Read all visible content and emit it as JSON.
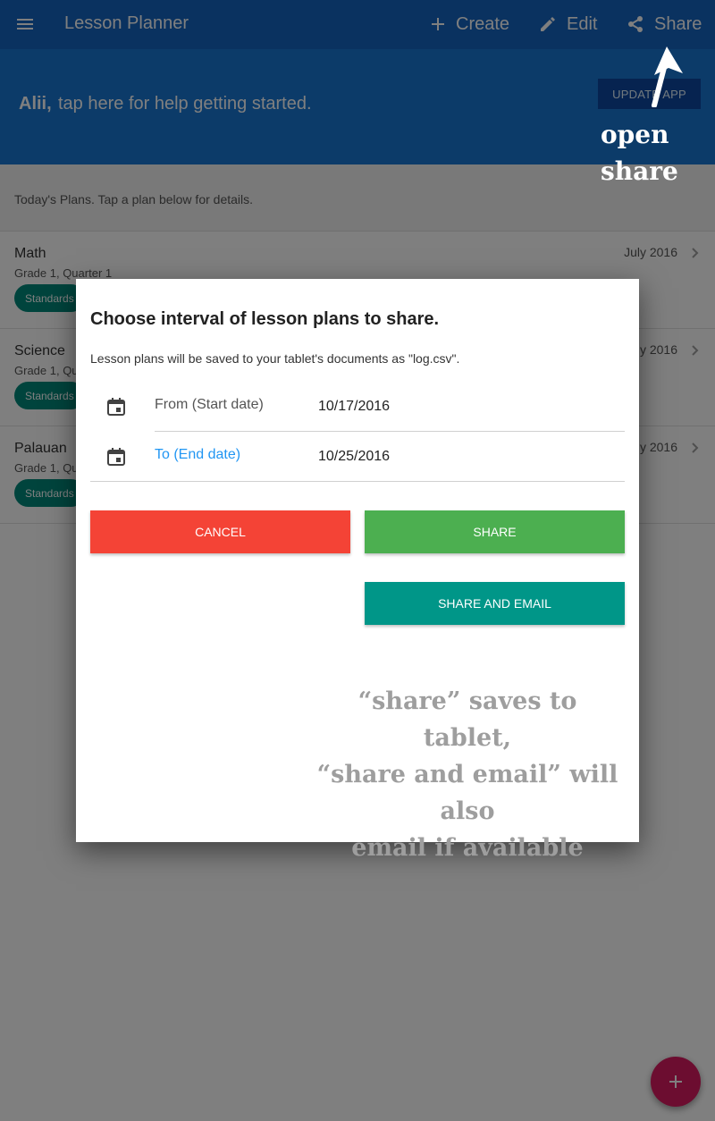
{
  "appbar": {
    "title": "Lesson Planner",
    "menu_icon": "menu-icon",
    "actions": [
      {
        "label": "Create",
        "icon": "plus-icon"
      },
      {
        "label": "Edit",
        "icon": "pencil-icon"
      },
      {
        "label": "Share",
        "icon": "share-icon"
      }
    ]
  },
  "banner": {
    "name": "Alii,",
    "help": "tap here for help getting started.",
    "update_button": "UPDATE APP"
  },
  "annotation_top": {
    "line1": "open",
    "line2": "share"
  },
  "today": {
    "text": "Today's Plans. Tap a plan below for details."
  },
  "plans": [
    {
      "subject": "Math",
      "grade": "Grade 1, Quarter 1",
      "chip": "Standards",
      "date": "July 2016"
    },
    {
      "subject": "Science",
      "grade": "Grade 1, Qu",
      "chip": "Standards",
      "date": "y 2016"
    },
    {
      "subject": "Palauan",
      "grade": "Grade 1, Qu",
      "chip": "Standards",
      "date": "y 2016"
    }
  ],
  "dialog": {
    "title": "Choose interval of lesson plans to share.",
    "subtitle": "Lesson plans will be saved to your tablet's documents as \"log.csv\".",
    "from_label": "From (Start date)",
    "from_value": "10/17/2016",
    "to_label": "To (End date)",
    "to_value": "10/25/2016",
    "cancel": "CANCEL",
    "share": "SHARE",
    "share_email": "SHARE AND EMAIL"
  },
  "annotation_note": {
    "line1": "“share” saves to tablet,",
    "line2": "“share and email” will also",
    "line3": "email if available"
  },
  "colors": {
    "appbar": "#1565c0",
    "banner": "#1976d2",
    "chip": "#00897b",
    "cancel": "#f44336",
    "share": "#4caf50",
    "share_email": "#009688",
    "fab": "#d81b60",
    "link": "#2196f3"
  }
}
